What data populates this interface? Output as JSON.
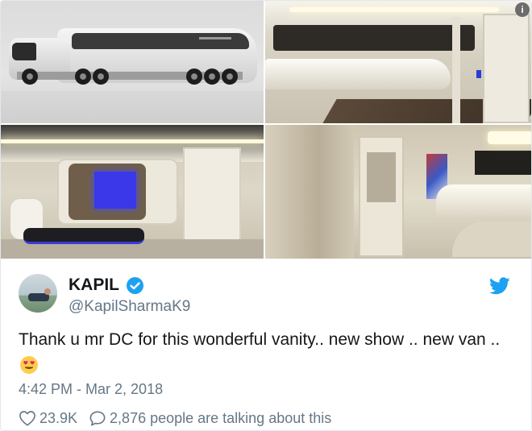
{
  "media": {
    "photos": [
      {
        "description_icon": "truck-exterior-photo"
      },
      {
        "description_icon": "lounge-interior-photo"
      },
      {
        "description_icon": "screen-interior-photo"
      },
      {
        "description_icon": "bathroom-interior-photo"
      }
    ],
    "info_icon_glyph": "i"
  },
  "author": {
    "name": "KAPIL",
    "handle": "@KapilSharmaK9",
    "verified": true
  },
  "tweet": {
    "text": "Thank u mr DC for this wonderful vanity.. new show .. new van ..",
    "emoji_icon": "heart-eyes-emoji-icon",
    "timestamp": "4:42 PM - Mar 2, 2018"
  },
  "engagement": {
    "likes": "23.9K",
    "conversation": "2,876 people are talking about this"
  },
  "colors": {
    "twitter_blue": "#1da1f2",
    "secondary_text": "#657786",
    "primary_text": "#14171a"
  }
}
